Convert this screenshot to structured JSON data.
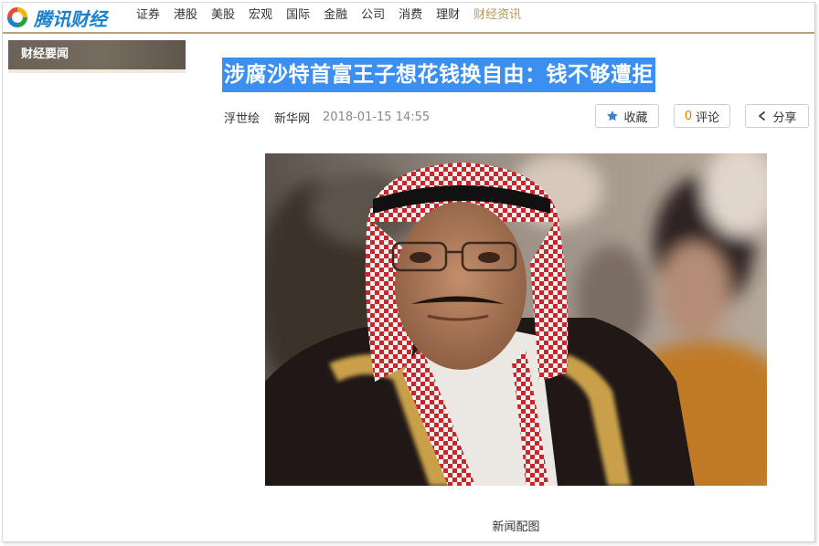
{
  "brand": {
    "name": "腾讯财经"
  },
  "nav": {
    "items": [
      {
        "label": "证券",
        "active": false
      },
      {
        "label": "港股",
        "active": false
      },
      {
        "label": "美股",
        "active": false
      },
      {
        "label": "宏观",
        "active": false
      },
      {
        "label": "国际",
        "active": false
      },
      {
        "label": "金融",
        "active": false
      },
      {
        "label": "公司",
        "active": false
      },
      {
        "label": "消费",
        "active": false
      },
      {
        "label": "理财",
        "active": false
      },
      {
        "label": "财经资讯",
        "active": true
      }
    ]
  },
  "section": {
    "title": "财经要闻"
  },
  "article": {
    "headline": "涉腐沙特首富王子想花钱换自由：钱不够遭拒",
    "author": "浮世绘",
    "source": "新华网",
    "time": "2018-01-15 14:55",
    "image_caption": "新闻配图"
  },
  "actions": {
    "favorite_label": "收藏",
    "comment_count": "0",
    "comment_label": "评论",
    "share_label": "分享"
  },
  "colors": {
    "accent": "#b8965a",
    "brand_blue": "#1a80d0",
    "highlight": "#3a8ff0",
    "section_bg": "#6e6459"
  },
  "icons": {
    "logo": "tencent-logo-icon",
    "favorite": "star-icon",
    "share": "share-icon"
  }
}
